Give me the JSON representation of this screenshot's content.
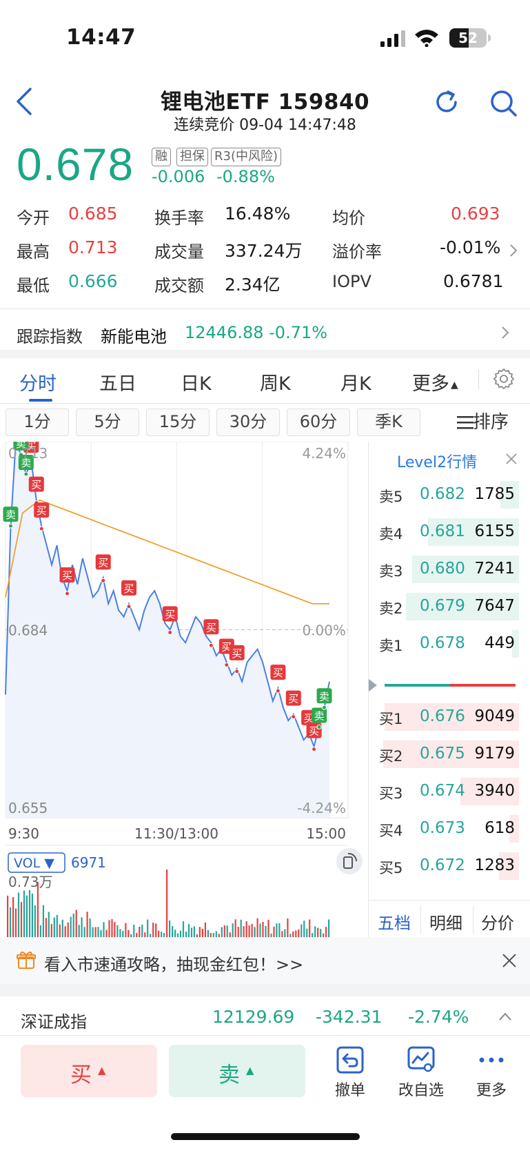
{
  "status": {
    "time": "14:47",
    "battery": "52"
  },
  "header": {
    "title": "锂电池ETF 159840",
    "subtitle": "连续竞价 09-04 14:47:48"
  },
  "price": {
    "last": "0.678",
    "tags": [
      "融",
      "担保",
      "R3(中风险)"
    ],
    "change": "-0.006",
    "change_pct": "-0.88%"
  },
  "quote": [
    {
      "label": "今开",
      "value": "0.685",
      "color": "red"
    },
    {
      "label": "最高",
      "value": "0.713",
      "color": "red"
    },
    {
      "label": "最低",
      "value": "0.666",
      "color": "green"
    },
    {
      "label": "换手率",
      "value": "16.48%"
    },
    {
      "label": "成交量",
      "value": "337.24万"
    },
    {
      "label": "成交额",
      "value": "2.34亿"
    },
    {
      "label": "均价",
      "value": "0.693",
      "color": "red"
    },
    {
      "label": "溢价率",
      "value": "-0.01%"
    },
    {
      "label": "IOPV",
      "value": "0.6781"
    }
  ],
  "tracking": {
    "label": "跟踪指数",
    "name": "新能电池",
    "value": "12446.88 -0.71%"
  },
  "tabs": [
    "分时",
    "五日",
    "日K",
    "周K",
    "月K",
    "更多"
  ],
  "periods": [
    "1分",
    "5分",
    "15分",
    "30分",
    "60分",
    "季K"
  ],
  "sort_label": "排序",
  "chart_labels": {
    "max_price": "0.713",
    "base_price": "0.684",
    "min_price": "0.655",
    "max_pct": "4.24%",
    "base_pct": "0.00%",
    "min_pct": "-4.24%",
    "t_start": "9:30",
    "t_mid": "11:30/13:00",
    "t_end": "15:00",
    "vol_btn": "VOL",
    "vol_value": "6971",
    "vol_max": "0.73万",
    "buy_mark": "买",
    "sell_mark": "卖"
  },
  "chart_data": {
    "type": "line",
    "ylim": [
      0.655,
      0.713
    ],
    "base": 0.684,
    "price_line": [
      0.674,
      0.7,
      0.713,
      0.711,
      0.708,
      0.71,
      0.704,
      0.7,
      0.697,
      0.694,
      0.697,
      0.692,
      0.69,
      0.694,
      0.691,
      0.695,
      0.692,
      0.689,
      0.69,
      0.692,
      0.688,
      0.69,
      0.687,
      0.686,
      0.688,
      0.686,
      0.684,
      0.687,
      0.689,
      0.69,
      0.688,
      0.685,
      0.684,
      0.686,
      0.683,
      0.682,
      0.684,
      0.686,
      0.685,
      0.683,
      0.682,
      0.68,
      0.681,
      0.679,
      0.677,
      0.678,
      0.676,
      0.679,
      0.68,
      0.681,
      0.679,
      0.676,
      0.673,
      0.675,
      0.672,
      0.67,
      0.671,
      0.669,
      0.667,
      0.668,
      0.666,
      0.669,
      0.672,
      0.676
    ],
    "avg_line": [
      0.689,
      0.702,
      0.704,
      0.703,
      0.702,
      0.701,
      0.7,
      0.699,
      0.698,
      0.697,
      0.696,
      0.695,
      0.694,
      0.693,
      0.692,
      0.691,
      0.69,
      0.689,
      0.688,
      0.688
    ]
  },
  "orderbook": {
    "title": "Level2行情",
    "asks": [
      {
        "label": "卖5",
        "price": "0.682",
        "vol": "1785",
        "ratio": 0.13
      },
      {
        "label": "卖4",
        "price": "0.681",
        "vol": "6155",
        "ratio": 0.64
      },
      {
        "label": "卖3",
        "price": "0.680",
        "vol": "7241",
        "ratio": 0.75
      },
      {
        "label": "卖2",
        "price": "0.679",
        "vol": "7647",
        "ratio": 0.79
      },
      {
        "label": "卖1",
        "price": "0.678",
        "vol": "449",
        "ratio": 0.05
      }
    ],
    "bids": [
      {
        "label": "买1",
        "price": "0.676",
        "vol": "9049",
        "ratio": 0.94
      },
      {
        "label": "买2",
        "price": "0.675",
        "vol": "9179",
        "ratio": 0.95
      },
      {
        "label": "买3",
        "price": "0.674",
        "vol": "3940",
        "ratio": 0.41
      },
      {
        "label": "买4",
        "price": "0.673",
        "vol": "618",
        "ratio": 0.07
      },
      {
        "label": "买5",
        "price": "0.672",
        "vol": "1283",
        "ratio": 0.14
      }
    ],
    "tabs": [
      "五档",
      "明细",
      "分价"
    ]
  },
  "banner": {
    "text": "看入市速通攻略，抽现金红包！>>"
  },
  "index_bar": {
    "name": "深证成指",
    "value": "12129.69",
    "change": "-342.31",
    "pct": "-2.74%"
  },
  "bottom": {
    "buy": "买",
    "sell": "卖",
    "cancel": "撤单",
    "watchlist": "改自选",
    "more": "更多"
  },
  "colors": {
    "up": "#e94040",
    "down": "#1aa784",
    "accent": "#2a63c9",
    "avg": "#f0a030",
    "line": "#4a7fe0"
  }
}
